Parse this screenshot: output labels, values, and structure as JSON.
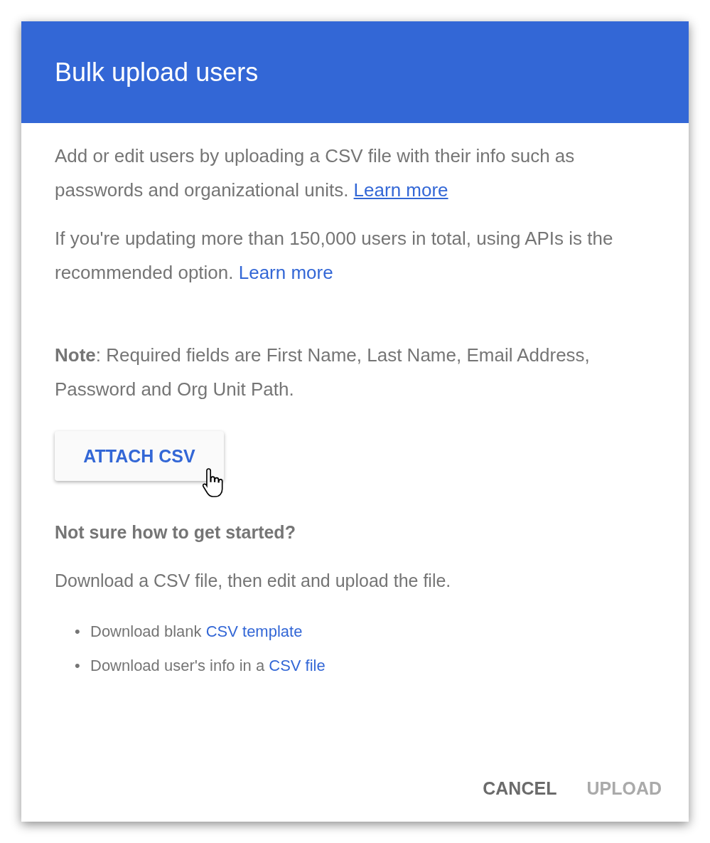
{
  "dialog": {
    "title": "Bulk upload users",
    "paragraphs": [
      {
        "text": "Add or edit users by uploading a CSV file with their info such as passwords and organizational units.",
        "link": "Learn more",
        "underlined": true
      },
      {
        "text": "If you're updating more than 150,000 users in total, using APIs is the recommended option.",
        "link": "Learn more",
        "underlined": false
      }
    ],
    "note": "**Note**: Required fields are First Name, Last Name, Email Address, Password and Org Unit Path.",
    "attach_button": "ATTACH CSV",
    "help_heading": "Not sure how to get started?",
    "help_text": "Download a CSV file, then edit and upload the file.",
    "downloads": [
      {
        "bullet": "•",
        "text": "Download blank",
        "link": "CSV template"
      },
      {
        "bullet": "•",
        "text": "Download user's info in a",
        "link": "CSV file"
      }
    ],
    "buttons": [
      {
        "label": "CANCEL",
        "disabled": false
      },
      {
        "label": "UPLOAD",
        "disabled": true
      }
    ]
  }
}
